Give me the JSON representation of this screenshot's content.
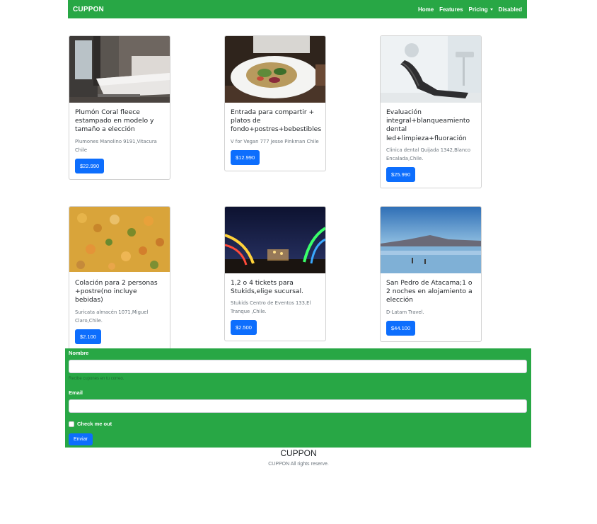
{
  "navbar": {
    "brand": "CUPPON",
    "links": [
      {
        "label": "Home"
      },
      {
        "label": "Features"
      },
      {
        "label": "Pricing"
      },
      {
        "label": "Disabled"
      }
    ]
  },
  "cards": [
    {
      "title": "Plumón Coral fleece estampado en modelo y tamaño a elección",
      "text": "Plumones Manolino 9191,Vitacura Chile",
      "price": "$22.990",
      "image": "bedroom-photo"
    },
    {
      "title": "Entrada para compartir + platos de fondo+postres+bebestibles",
      "text": "V for Vegan 777 Jesse Pinkman Chile",
      "price": "$12.990",
      "image": "salad-plate-photo"
    },
    {
      "title": "Evaluación integral+blanqueamiento dental led+limpieza+fluoración",
      "text": "Clinica dental Quijada 1342,Blanco Encalada,Chile.",
      "price": "$25.990",
      "image": "dental-chair-photo"
    },
    {
      "title": "Colación para 2 personas +postre(no incluye bebidas)",
      "text": "Suricata almacén 1071,Miguel Claro,Chile.",
      "price": "$2.100",
      "image": "food-dish-photo"
    },
    {
      "title": "1,2 o 4 tickets para Stukids,elige sucursal.",
      "text": "Stukids Centro de Eventos 133,El Tranque ,Chile.",
      "price": "$2.500",
      "image": "amusement-park-photo"
    },
    {
      "title": "San Pedro de Atacama;1 o 2 noches en alojamiento a elección",
      "text": "D-Latam Travel.",
      "price": "$44.100",
      "image": "salt-flat-photo"
    }
  ],
  "form": {
    "name_label": "Nombre",
    "name_help": "Recibe cupones en tu correo.",
    "email_label": "Email",
    "check_label": "Check me out",
    "submit_label": "Enviar"
  },
  "footer": {
    "title": "CUPPON",
    "text": "CUPPON All rights reserve."
  }
}
